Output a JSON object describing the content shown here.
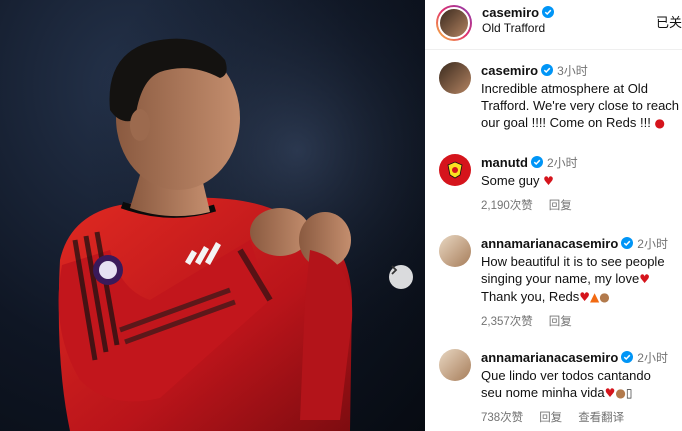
{
  "post": {
    "username": "casemiro",
    "location": "Old Trafford",
    "follow_label": "已关"
  },
  "colors": {
    "united_red": "#d5141c",
    "link_blue": "#0095f6",
    "muted_text": "#737373"
  },
  "icons": {
    "verified": "verified-badge-icon",
    "next": "chevron-right-icon",
    "heart": "red-heart-icon",
    "fire": "fire-icon",
    "muscle": "flexed-biceps-icon",
    "red_circle": "red-circle-icon"
  },
  "comments": [
    {
      "username": "casemiro",
      "time": "3小时",
      "lines": [
        "Incredible atmosphere at Old",
        "Trafford. We're very close to reach",
        "our goal !!!! Come on Reds !!!"
      ]
    },
    {
      "username": "manutd",
      "time": "2小时",
      "lines": [
        "Some guy"
      ],
      "likes": "2,190次赞",
      "reply": "回复"
    },
    {
      "username": "annamarianacasemiro",
      "time": "2小时",
      "lines": [
        "How beautiful it is to see people",
        "singing your name, my love",
        "Thank you, Reds"
      ],
      "likes": "2,357次赞",
      "reply": "回复"
    },
    {
      "username": "annamarianacasemiro",
      "time": "2小时",
      "lines": [
        "Que lindo ver todos cantando",
        "seu nome minha vida"
      ],
      "likes": "738次赞",
      "reply": "回复",
      "translate": "查看翻译"
    }
  ]
}
